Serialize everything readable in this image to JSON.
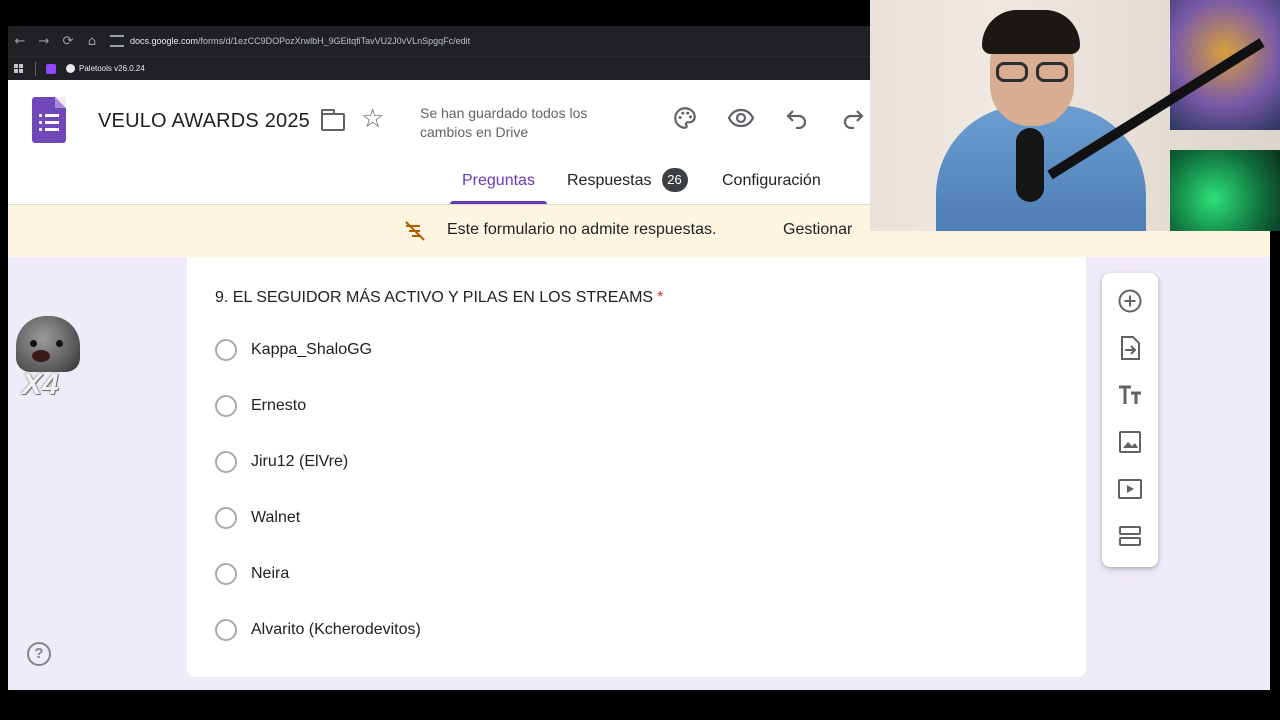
{
  "browser": {
    "url_domain": "docs.google.com",
    "url_path": "/forms/d/1ezCC9DOPozXrwlbH_9GEitqfiTavVU2J0vVLnSpgqFc/edit",
    "bookmark_label": "Paletools v26.0.24"
  },
  "form": {
    "title": "VEULO AWARDS 2025",
    "save_status": "Se han guardado todos los cambios en Drive",
    "tabs": [
      {
        "label": "Preguntas"
      },
      {
        "label": "Respuestas",
        "count": "26"
      },
      {
        "label": "Configuración"
      }
    ]
  },
  "banner": {
    "message": "Este formulario no admite respuestas.",
    "action": "Gestionar"
  },
  "question": {
    "title": "9. EL SEGUIDOR MÁS ACTIVO Y PILAS EN LOS STREAMS",
    "required_mark": "*",
    "options": [
      "Kappa_ShaloGG",
      "Ernesto",
      "Jiru12 (ElVre)",
      "Walnet",
      "Neira",
      "Alvarito (Kcherodevitos)"
    ]
  },
  "sidebar_tools": [
    "add-question-icon",
    "import-questions-icon",
    "add-title-icon",
    "add-image-icon",
    "add-video-icon",
    "add-section-icon"
  ],
  "overlay": {
    "emote_multiplier": "X4"
  },
  "colors": {
    "accent": "#673ab7",
    "background": "#f0ebf8",
    "banner": "#fdf5e0",
    "required": "#d93025"
  }
}
